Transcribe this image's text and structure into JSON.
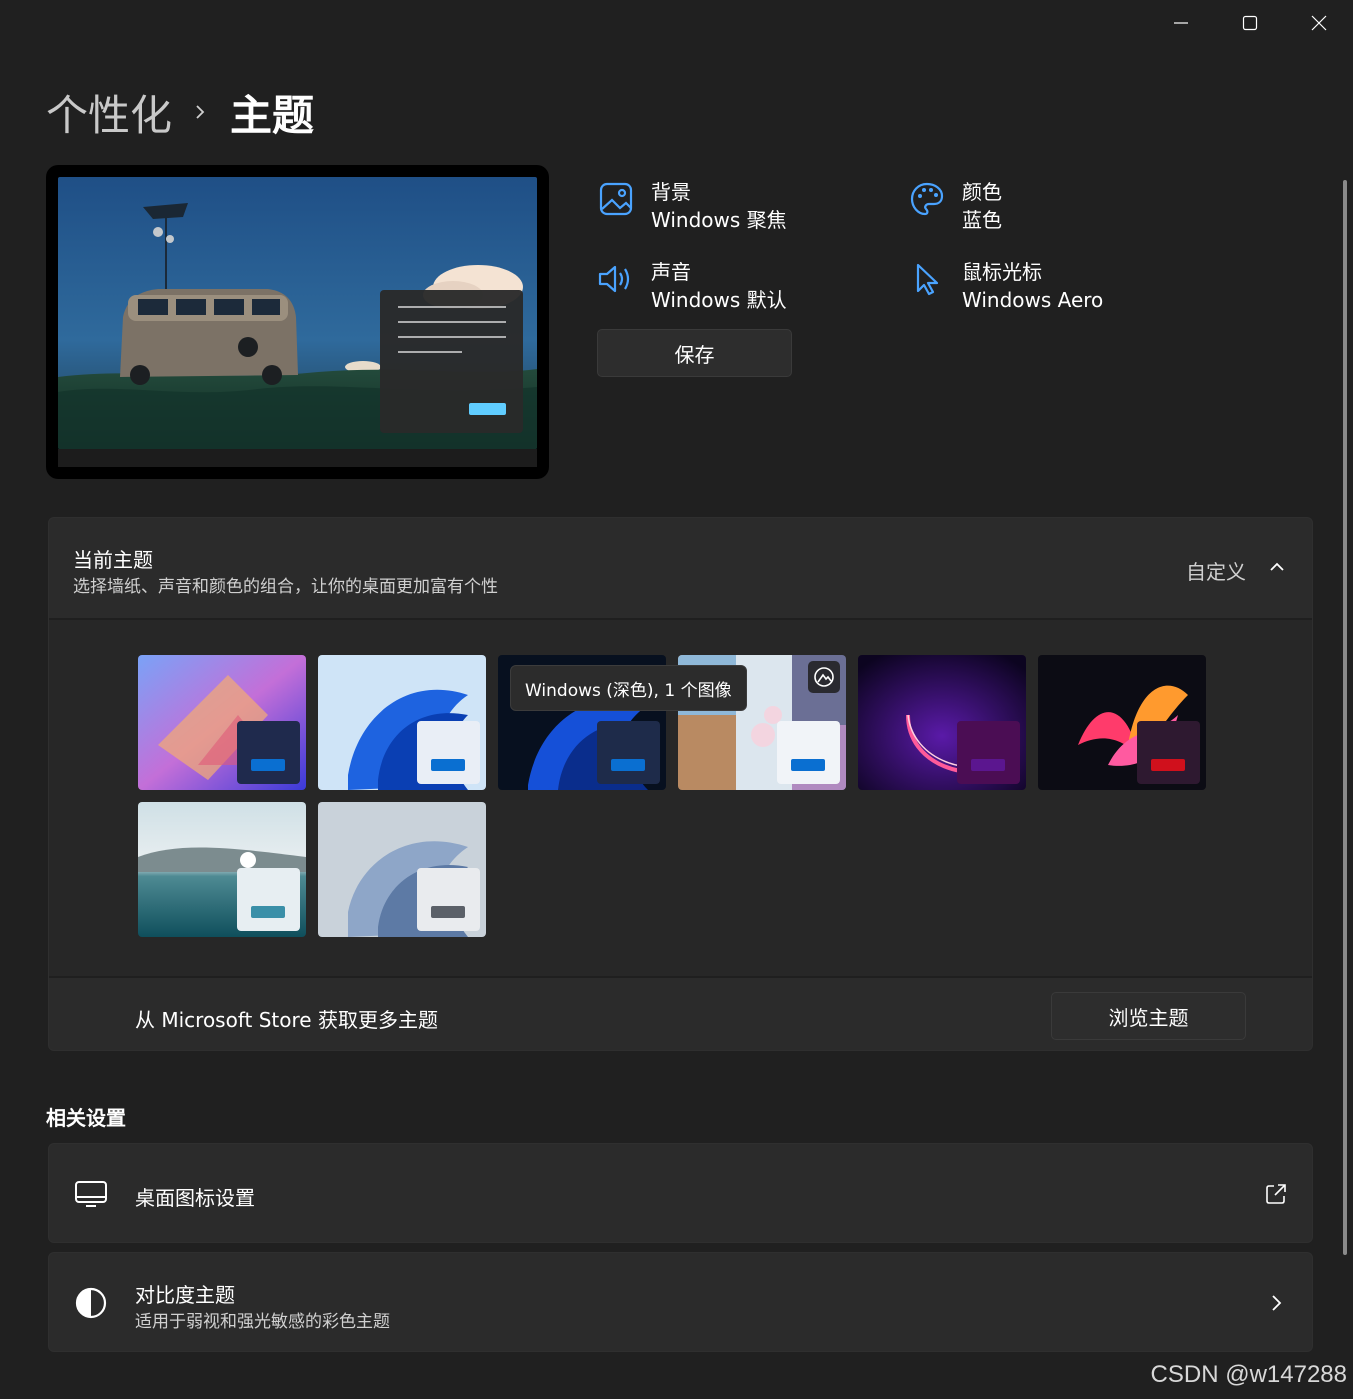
{
  "breadcrumb": {
    "parent": "个性化",
    "current": "主题"
  },
  "caption": {
    "minimize": "minimize-icon",
    "maximize": "maximize-icon",
    "close": "close-icon"
  },
  "properties": {
    "background": {
      "label": "背景",
      "value": "Windows 聚焦",
      "icon": "image-icon"
    },
    "color": {
      "label": "颜色",
      "value": "蓝色",
      "icon": "palette-icon"
    },
    "sound": {
      "label": "声音",
      "value": "Windows 默认",
      "icon": "speaker-icon"
    },
    "cursor": {
      "label": "鼠标光标",
      "value": "Windows Aero",
      "icon": "pointer-icon"
    },
    "save_label": "保存"
  },
  "current_theme": {
    "title": "当前主题",
    "subtitle": "选择墙纸、声音和颜色的组合，让你的桌面更加富有个性",
    "action_label": "自定义",
    "tooltip": "Windows (深色), 1 个图像",
    "tiles": [
      {
        "id": "glow",
        "accent": "#0a6fd1",
        "mini": "#1f2a4d"
      },
      {
        "id": "light",
        "accent": "#0a6fd1",
        "mini": "#e9eef6"
      },
      {
        "id": "dark",
        "accent": "#0a6fd1",
        "mini": "#1e2b4a"
      },
      {
        "id": "spotlight",
        "accent": "#0a6fd1",
        "mini": "#f1f4f8"
      },
      {
        "id": "captured-motion",
        "accent": "#5b168f",
        "mini": "#4b0d54"
      },
      {
        "id": "flow",
        "accent": "#d0101c",
        "mini": "#2e1930"
      },
      {
        "id": "sunrise",
        "accent": "#3a8fa8",
        "mini": "#e7eef2"
      },
      {
        "id": "bloom-gray",
        "accent": "#5b6068",
        "mini": "#e9ebee"
      }
    ],
    "store_text": "从 Microsoft Store 获取更多主题",
    "browse_label": "浏览主题"
  },
  "related": {
    "title": "相关设置",
    "desktop_icons": {
      "title": "桌面图标设置",
      "icon": "monitor-icon",
      "right_icon": "external-link-icon"
    },
    "contrast": {
      "title": "对比度主题",
      "subtitle": "适用于弱视和强光敏感的彩色主题",
      "icon": "contrast-icon",
      "right_icon": "chevron-right-icon"
    }
  },
  "watermark": "CSDN @w147288",
  "colors": {
    "accent": "#60cdff",
    "icon_blue": "#4aa3ff"
  }
}
